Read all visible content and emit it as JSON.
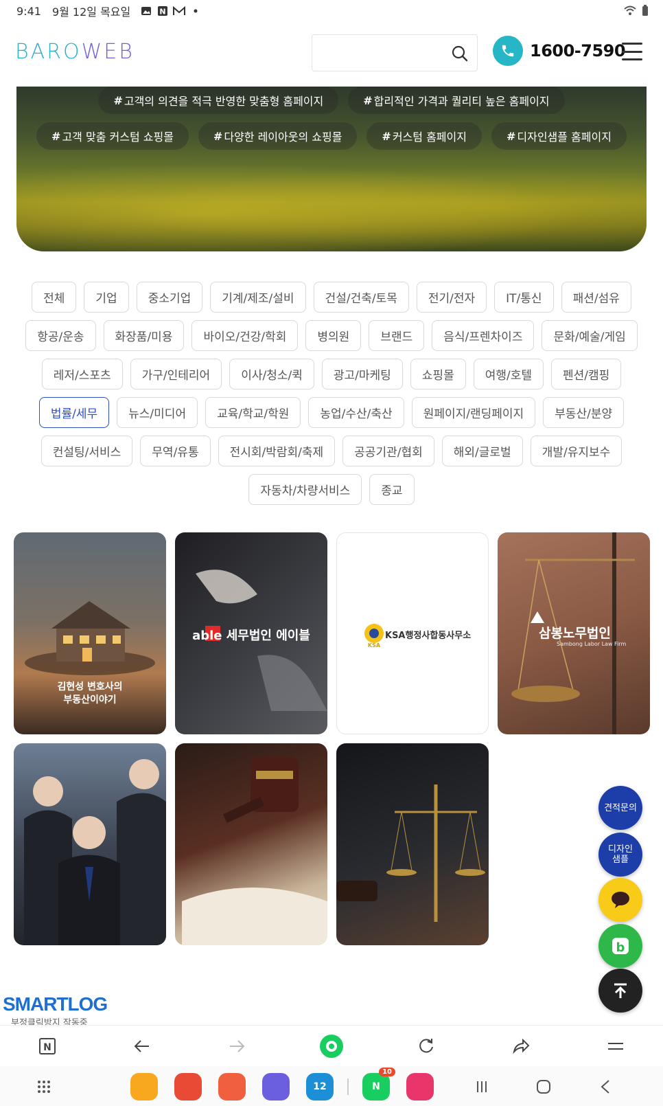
{
  "status_bar": {
    "time": "9:41",
    "date": "9월 12일 목요일",
    "icons": [
      "gallery-icon",
      "naver-n-icon",
      "mail-icon",
      "dot-icon"
    ],
    "right_icons": [
      "wifi-icon",
      "battery-icon"
    ]
  },
  "header": {
    "logo_part1": "BARO",
    "logo_part2": "WEB",
    "search_placeholder": "",
    "phone_number": "1600-7590",
    "brand_color": "#26b6c6",
    "accent_color": "#6f63d8"
  },
  "banner": {
    "tags_row1": [
      "고객의 의견을 적극 반영한 맞춤형 홈페이지",
      "합리적인 가격과 퀄리티 높은 홈페이지"
    ],
    "tags_row2": [
      "고객 맞춤 커스텀 쇼핑몰",
      "다양한 레이아웃의 쇼핑몰",
      "커스텀 홈페이지",
      "디자인샘플 홈페이지"
    ],
    "hash": "#"
  },
  "categories": {
    "row1": [
      "전체",
      "기업",
      "중소기업",
      "기계/제조/설비",
      "건설/건축/토목",
      "전기/전자",
      "IT/통신",
      "패션/섬유"
    ],
    "row2": [
      "항공/운송",
      "화장품/미용",
      "바이오/건강/학회",
      "병의원",
      "브랜드",
      "음식/프렌차이즈",
      "문화/예술/게임"
    ],
    "row3": [
      "레저/스포츠",
      "가구/인테리어",
      "이사/청소/퀵",
      "광고/마케팅",
      "쇼핑몰",
      "여행/호텔",
      "펜션/캠핑"
    ],
    "row4": [
      "법률/세무",
      "뉴스/미디어",
      "교육/학교/학원",
      "농업/수산/축산",
      "원페이지/랜딩페이지",
      "부동산/분양"
    ],
    "row5": [
      "컨설팅/서비스",
      "무역/유통",
      "전시회/박람회/축제",
      "공공기관/협회",
      "해외/글로벌",
      "개발/유지보수"
    ],
    "row6": [
      "자동차/차량서비스",
      "종교"
    ],
    "active": "법률/세무",
    "active_color": "#2f4fc5"
  },
  "gallery": {
    "card1_text": "김현성 변호사의\n부동산이야기",
    "card2_text": "able 세무법인 에이블",
    "card3_text": "KSA행정사합동사무소",
    "card3_badge": "KSA",
    "card4_text": "삼봉노무법인",
    "card4_sub": "Sambong Labor Law Firm"
  },
  "floating": {
    "quote": "견적문의",
    "design": "디자인\n샘플",
    "kakao": "kakao-chat-icon",
    "blog": "blog-icon",
    "top": "scroll-top-icon"
  },
  "smartlog": {
    "title": "SMARTLOG",
    "subtitle": "부정클릭방지 작동중"
  },
  "browser_toolbar": [
    "naver-home-icon",
    "back-icon",
    "forward-icon",
    "green-dot-icon",
    "refresh-icon",
    "share-icon",
    "menu-icon"
  ],
  "dock": {
    "calendar_day": "12",
    "naver_badge": "10"
  }
}
